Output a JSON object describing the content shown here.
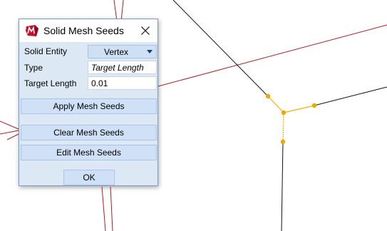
{
  "dialog": {
    "title": "Solid Mesh Seeds",
    "app_icon": "abaqus-app-icon",
    "close_icon": "close-icon"
  },
  "form": {
    "solid_entity_label": "Solid Entity",
    "solid_entity_value": "Vertex",
    "type_label": "Type",
    "type_value": "Target Length",
    "target_length_label": "Target Length",
    "target_length_value": "0.01"
  },
  "buttons": {
    "apply": "Apply Mesh Seeds",
    "clear": "Clear Mesh Seeds",
    "edit": "Edit Mesh Seeds",
    "ok": "OK"
  },
  "colors": {
    "geometry_red": "#b01e1e",
    "geometry_black": "#111111",
    "selected_edge": "#f2b400",
    "seed_vertex": "#f0a800"
  }
}
